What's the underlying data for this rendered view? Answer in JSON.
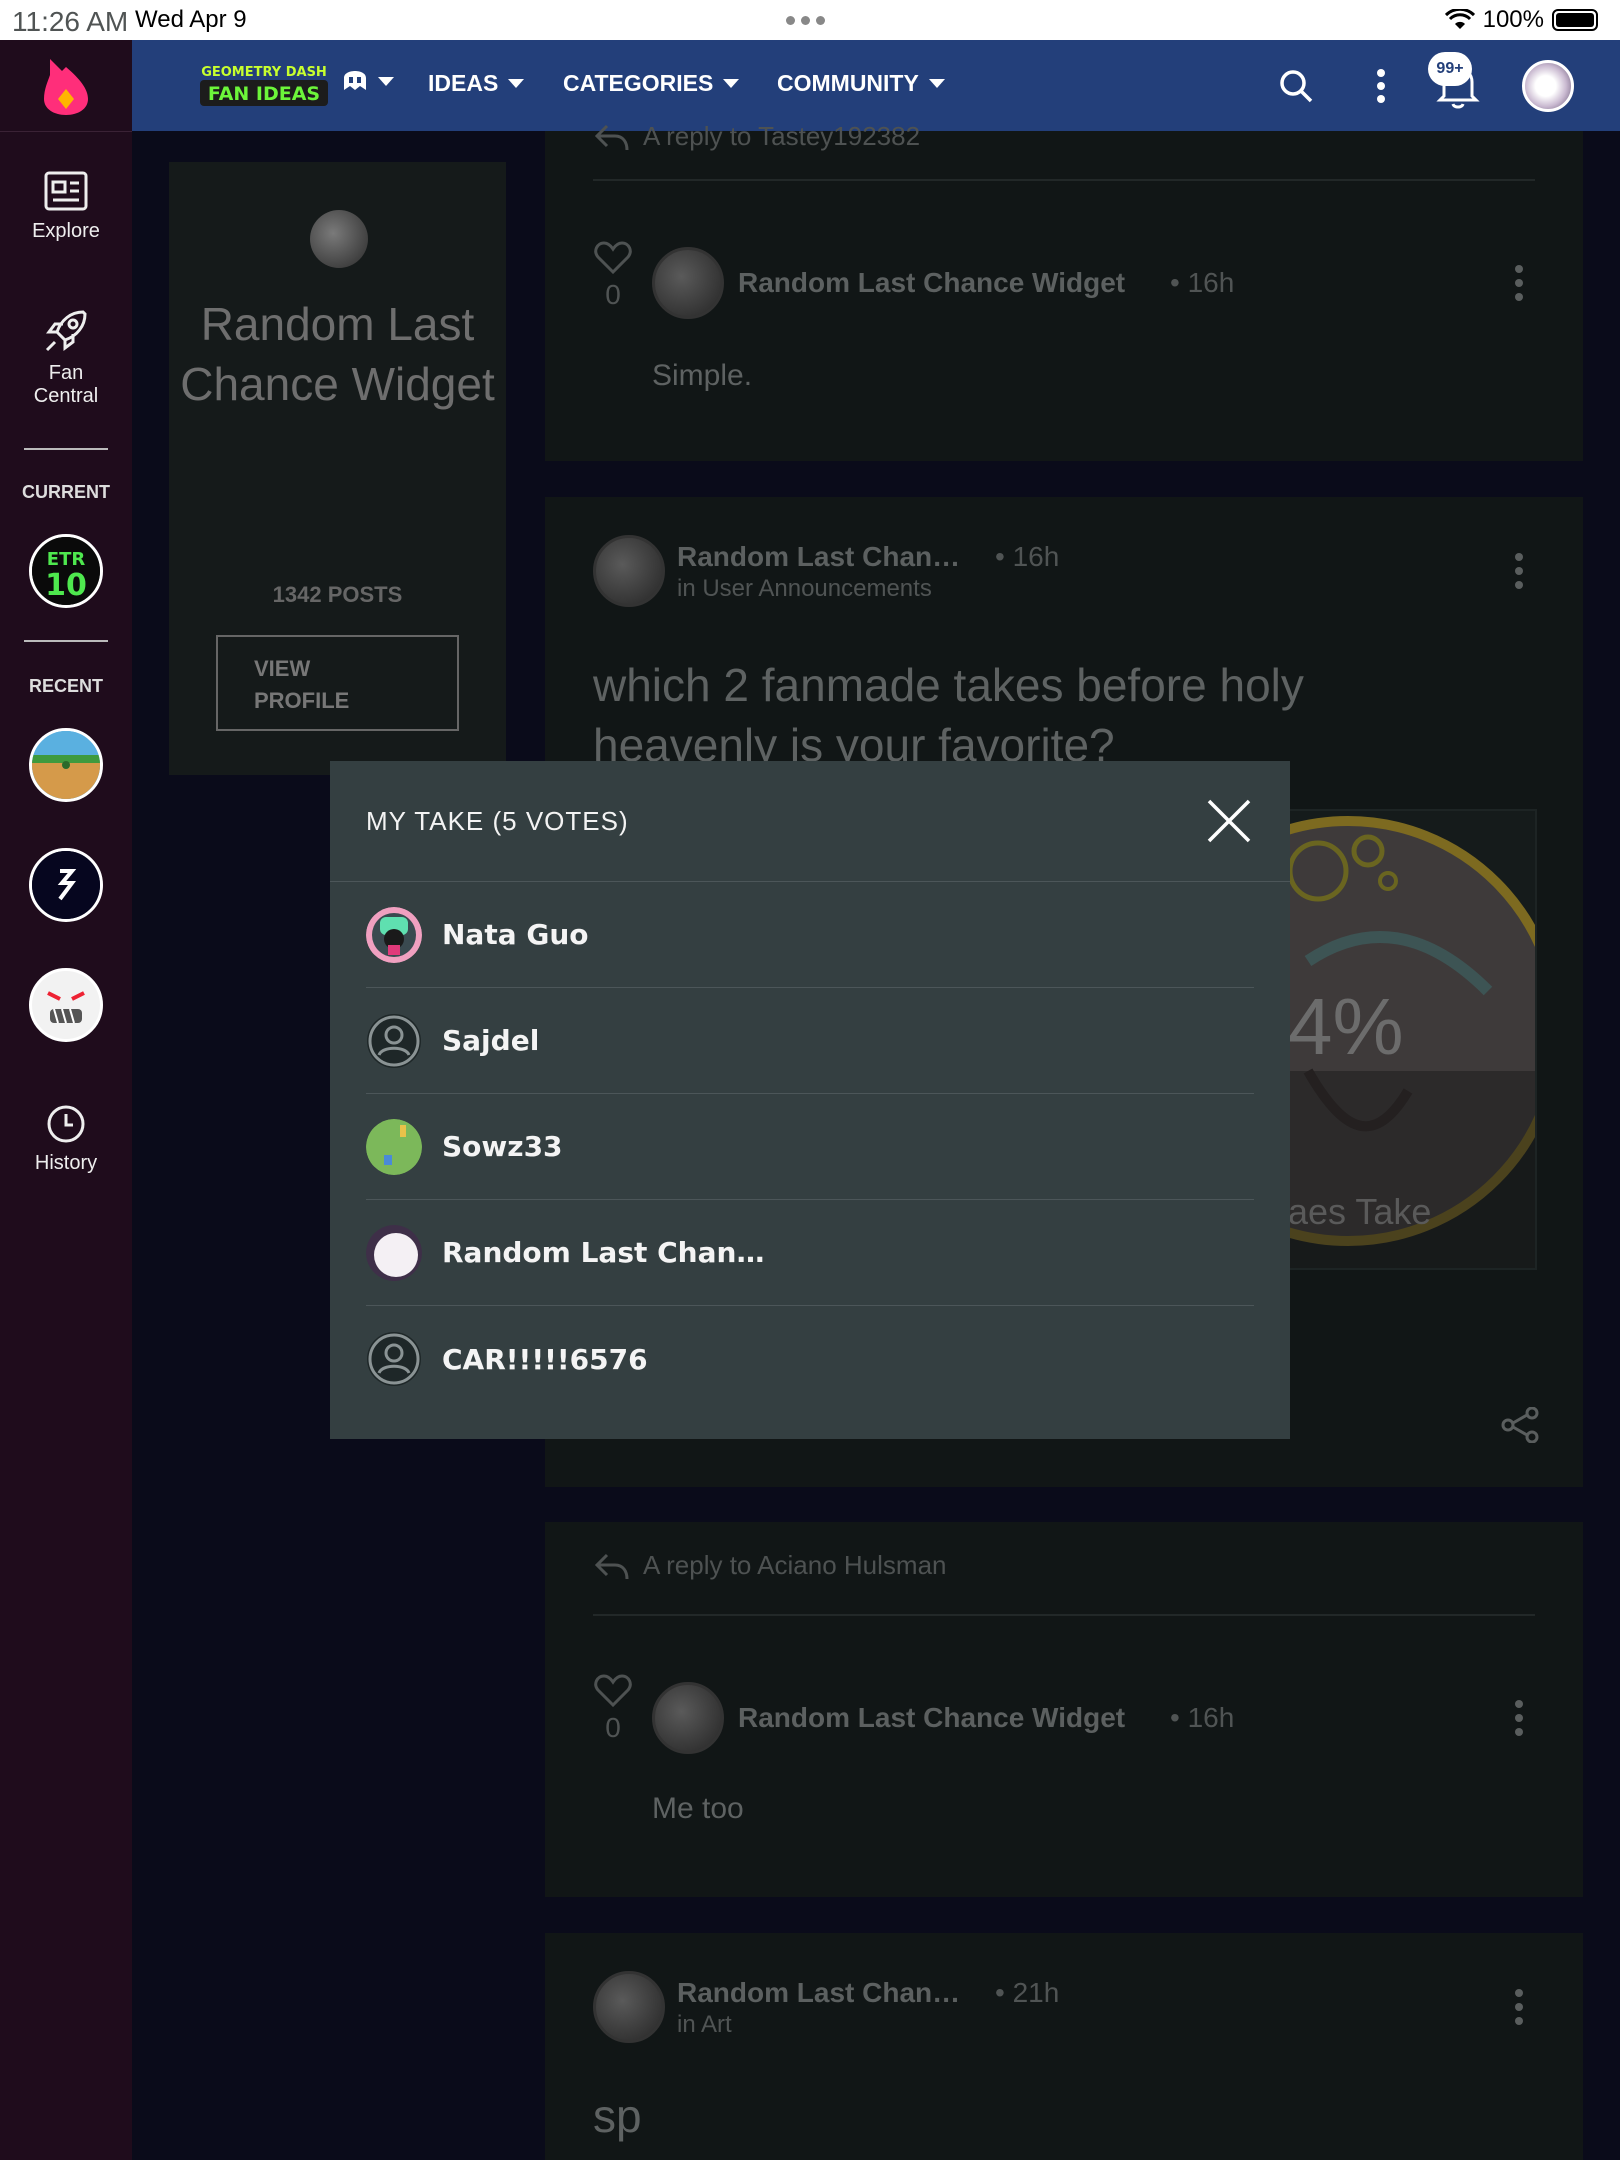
{
  "status_bar": {
    "time": "11:26 AM",
    "date": "Wed Apr 9",
    "battery": "100%"
  },
  "sidebar": {
    "items": [
      {
        "label": "Explore",
        "icon": "explore-icon"
      },
      {
        "label_line1": "Fan",
        "label_line2": "Central",
        "icon": "rocket-icon"
      }
    ],
    "current_heading": "CURRENT",
    "recent_heading": "RECENT",
    "history_label": "History"
  },
  "topbar": {
    "brand_line1": "GEOMETRY DASH",
    "brand_line2": "FAN IDEAS",
    "nav": [
      {
        "label": "IDEAS"
      },
      {
        "label": "CATEGORIES"
      },
      {
        "label": "COMMUNITY"
      }
    ],
    "notification_badge": "99+"
  },
  "profile_card": {
    "name": "Random Last Chance Widget",
    "posts": "1342 POSTS",
    "view_profile_line1": "VIEW",
    "view_profile_line2": "PROFILE"
  },
  "feed": {
    "card1": {
      "reply_to": "A reply to Tastey192382",
      "likes": "0",
      "author": "Random Last Chance Widget",
      "time": "16h",
      "text": "Simple."
    },
    "card2": {
      "author": "Random Last Chan…",
      "time": "16h",
      "location": "in User Announcements",
      "title": "which 2 fanmade takes before holy heavenly is your favorite?",
      "poll_percent": "4%",
      "poll_label": "aes Take"
    },
    "card3": {
      "reply_to": "A reply to Aciano Hulsman",
      "likes": "0",
      "author": "Random Last Chance Widget",
      "time": "16h",
      "text": "Me too"
    },
    "card4": {
      "author": "Random Last Chan…",
      "time": "21h",
      "location": "in Art",
      "text": "sp"
    }
  },
  "modal": {
    "title": "MY TAKE (5 VOTES)",
    "voters": [
      {
        "name": "Nata Guo",
        "avatar": "nata"
      },
      {
        "name": "Sajdel",
        "avatar": "default"
      },
      {
        "name": "Sowz33",
        "avatar": "sowz"
      },
      {
        "name": "Random Last Chan…",
        "avatar": "random"
      },
      {
        "name": "CAR!!!!!6576",
        "avatar": "default"
      }
    ]
  },
  "colors": {
    "topbar": "#233f7a",
    "sidebar": "#1f0c1c",
    "modal": "#343f41",
    "page": "#0a0b1a",
    "logo_flame": "#ff2e7a"
  }
}
